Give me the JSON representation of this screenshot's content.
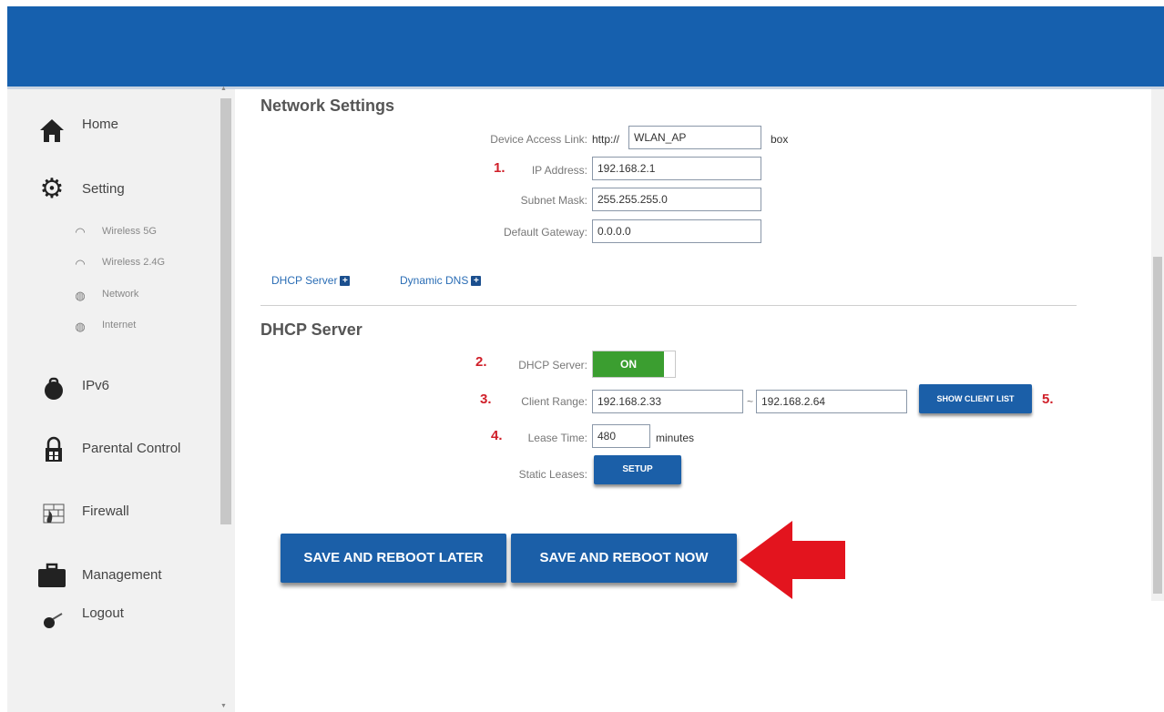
{
  "colors": {
    "header": "#1660ae",
    "button": "#1b5fa8",
    "toggle_on": "#3b9e30",
    "step_number": "#d0202a",
    "arrow": "#e3141e"
  },
  "sidebar": {
    "items": [
      {
        "label": "Home",
        "icon": "home-icon"
      },
      {
        "label": "Setting",
        "icon": "gear-icon"
      },
      {
        "label": "IPv6",
        "icon": "ipv6-icon"
      },
      {
        "label": "Parental Control",
        "icon": "lock-icon"
      },
      {
        "label": "Firewall",
        "icon": "firewall-icon"
      },
      {
        "label": "Management",
        "icon": "briefcase-icon"
      },
      {
        "label": "Logout",
        "icon": "logout-icon"
      }
    ],
    "subitems": [
      {
        "label": "Wireless 5G",
        "icon": "wifi-icon"
      },
      {
        "label": "Wireless 2.4G",
        "icon": "wifi-icon"
      },
      {
        "label": "Network",
        "icon": "globe-icon"
      },
      {
        "label": "Internet",
        "icon": "globe-icon"
      }
    ]
  },
  "network_settings": {
    "title": "Network Settings",
    "device_access_link": {
      "label": "Device Access Link:",
      "prefix": "http://",
      "value": "WLAN_AP",
      "suffix": "box"
    },
    "ip_address": {
      "step": "1.",
      "label": "IP Address:",
      "value": "192.168.2.1"
    },
    "subnet_mask": {
      "label": "Subnet Mask:",
      "value": "255.255.255.0"
    },
    "default_gateway": {
      "label": "Default Gateway:",
      "value": "0.0.0.0"
    }
  },
  "links": {
    "dhcp_server": "DHCP Server",
    "dynamic_dns": "Dynamic DNS"
  },
  "dhcp": {
    "title": "DHCP Server",
    "server": {
      "step": "2.",
      "label": "DHCP Server:",
      "state": "ON"
    },
    "client_range": {
      "step": "3.",
      "label": "Client Range:",
      "start": "192.168.2.33",
      "separator": "~",
      "end": "192.168.2.64"
    },
    "show_client_list": {
      "label": "SHOW CLIENT LIST",
      "step": "5."
    },
    "lease_time": {
      "step": "4.",
      "label": "Lease Time:",
      "value": "480",
      "unit": "minutes"
    },
    "static_leases": {
      "label": "Static Leases:",
      "button": "SETUP"
    }
  },
  "actions": {
    "save_later": "SAVE AND REBOOT LATER",
    "save_now": "SAVE AND REBOOT NOW"
  }
}
